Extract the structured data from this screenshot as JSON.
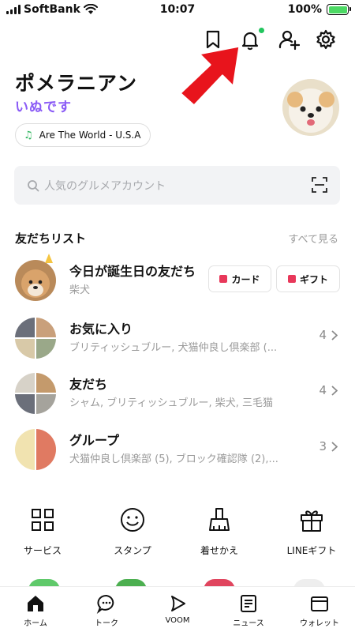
{
  "status_bar": {
    "carrier": "SoftBank",
    "time": "10:07",
    "battery": "100%",
    "battery_level": 1.0
  },
  "profile": {
    "name": "ポメラニアン",
    "status_message": "いぬです",
    "music": "Are The World - U.S.A"
  },
  "search": {
    "placeholder": "人気のグルメアカウント"
  },
  "friends": {
    "section_title": "友だちリスト",
    "see_all": "すべて見る",
    "birthday": {
      "title": "今日が誕生日の友だち",
      "subtitle": "柴犬",
      "card_button": "カード",
      "gift_button": "ギフト"
    },
    "rows": [
      {
        "title": "お気に入り",
        "subtitle": "ブリティッシュブルー, 犬猫仲良し倶楽部 (...",
        "count": "4"
      },
      {
        "title": "友だち",
        "subtitle": "シャム, ブリティッシュブルー, 柴犬, 三毛猫",
        "count": "4"
      },
      {
        "title": "グループ",
        "subtitle": "犬猫仲良し倶楽部 (5), ブロック確認隊 (2),...",
        "count": "3"
      }
    ]
  },
  "services": [
    {
      "label": "サービス",
      "icon": "grid-icon"
    },
    {
      "label": "スタンプ",
      "icon": "smile-icon"
    },
    {
      "label": "着せかえ",
      "icon": "brush-icon"
    },
    {
      "label": "LINEギフト",
      "icon": "gift-icon"
    }
  ],
  "tabs": [
    {
      "label": "ホーム",
      "icon": "home-icon",
      "active": true
    },
    {
      "label": "トーク",
      "icon": "chat-icon"
    },
    {
      "label": "VOOM",
      "icon": "voom-icon"
    },
    {
      "label": "ニュース",
      "icon": "news-icon"
    },
    {
      "label": "ウォレット",
      "icon": "wallet-icon"
    }
  ],
  "colors": {
    "accent_green": "#22c55e",
    "arrow_red": "#e8141c",
    "status_purple": "#8b5cf6"
  }
}
